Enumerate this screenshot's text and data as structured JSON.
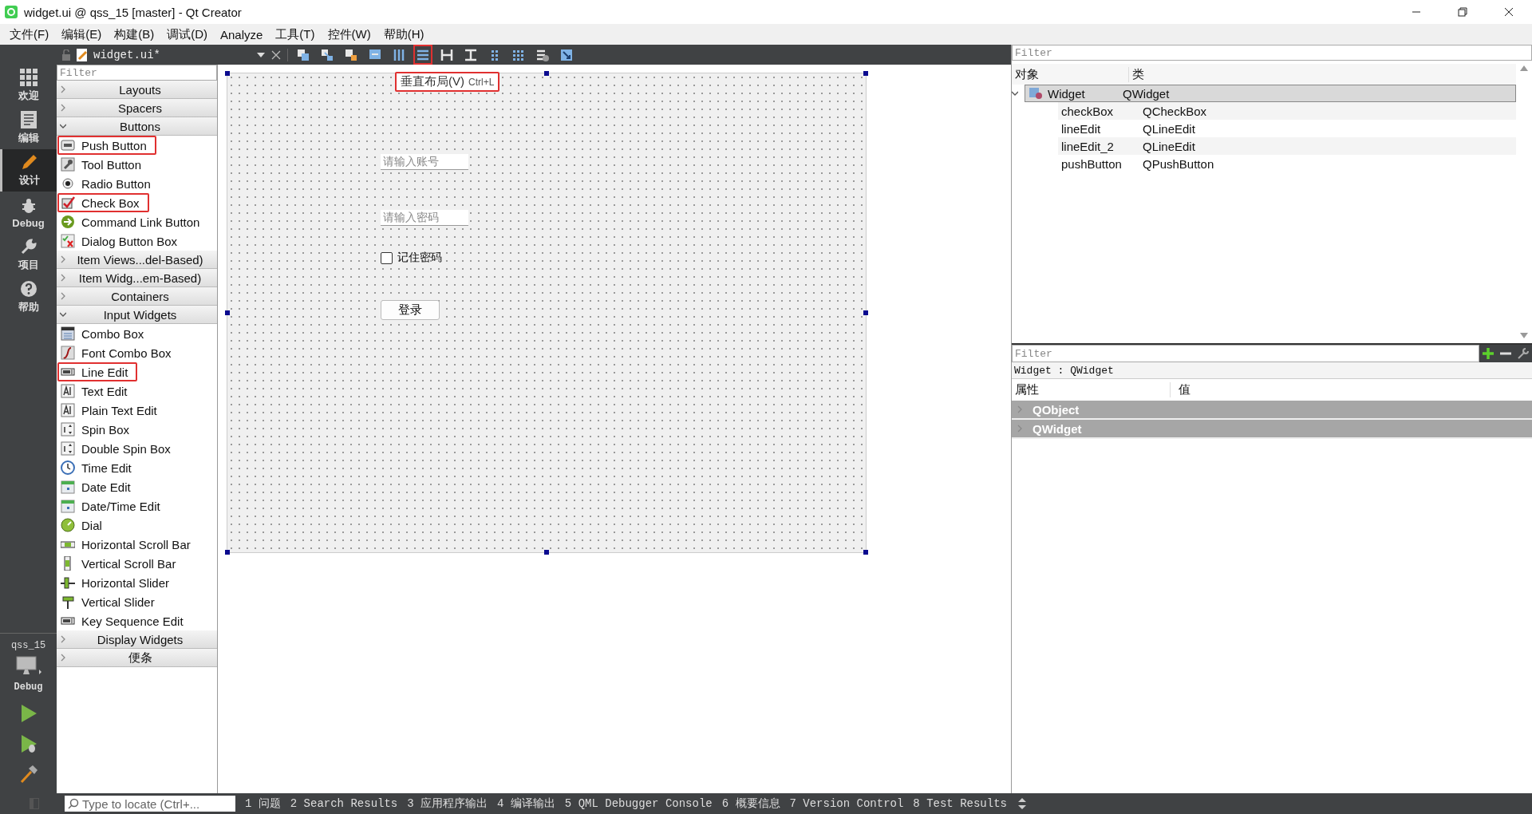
{
  "window": {
    "title": "widget.ui @ qss_15 [master] - Qt Creator"
  },
  "menu": [
    "文件(F)",
    "编辑(E)",
    "构建(B)",
    "调试(D)",
    "Analyze",
    "工具(T)",
    "控件(W)",
    "帮助(H)"
  ],
  "modes": [
    {
      "label": "欢迎",
      "kind": "grid",
      "selected": false
    },
    {
      "label": "编辑",
      "kind": "doc",
      "selected": false
    },
    {
      "label": "设计",
      "kind": "pencil",
      "selected": true
    },
    {
      "label": "Debug",
      "kind": "bug",
      "selected": false
    },
    {
      "label": "项目",
      "kind": "wrench",
      "selected": false
    },
    {
      "label": "帮助",
      "kind": "help",
      "selected": false
    }
  ],
  "kit": {
    "project": "qss_15",
    "config": "Debug"
  },
  "toolbar": {
    "file": "widget.ui*",
    "tools": [
      {
        "kind": "edit-widgets",
        "highlighted": false
      },
      {
        "kind": "signals",
        "highlighted": false
      },
      {
        "kind": "buddies",
        "highlighted": false
      },
      {
        "kind": "tab-order",
        "highlighted": false
      },
      {
        "kind": "h-layout",
        "highlighted": false
      },
      {
        "kind": "v-layout",
        "highlighted": true
      },
      {
        "kind": "h-splitter",
        "highlighted": false
      },
      {
        "kind": "v-splitter",
        "highlighted": false
      },
      {
        "kind": "form-layout",
        "highlighted": false
      },
      {
        "kind": "grid-layout",
        "highlighted": false
      },
      {
        "kind": "break-layout",
        "highlighted": false
      },
      {
        "kind": "adjust-size",
        "highlighted": false
      }
    ]
  },
  "tooltip": {
    "text": "垂直布局(V)",
    "shortcut": "Ctrl+L",
    "highlighted": true
  },
  "widget_box": {
    "filter_placeholder": "Filter",
    "sections": [
      {
        "title": "Layouts",
        "expanded": false
      },
      {
        "title": "Spacers",
        "expanded": false
      },
      {
        "title": "Buttons",
        "expanded": true,
        "items": [
          {
            "label": "Push Button",
            "kind": "ok",
            "highlighted": true
          },
          {
            "label": "Tool Button",
            "kind": "tool",
            "highlighted": false
          },
          {
            "label": "Radio Button",
            "kind": "radio",
            "highlighted": false
          },
          {
            "label": "Check Box",
            "kind": "check",
            "highlighted": true
          },
          {
            "label": "Command Link Button",
            "kind": "arrow",
            "highlighted": false
          },
          {
            "label": "Dialog Button Box",
            "kind": "dialog",
            "highlighted": false
          }
        ]
      },
      {
        "title": "Item Views...del-Based)",
        "expanded": false
      },
      {
        "title": "Item Widg...em-Based)",
        "expanded": false
      },
      {
        "title": "Containers",
        "expanded": false
      },
      {
        "title": "Input Widgets",
        "expanded": true,
        "items": [
          {
            "label": "Combo Box",
            "kind": "combo",
            "highlighted": false
          },
          {
            "label": "Font Combo Box",
            "kind": "font",
            "highlighted": false
          },
          {
            "label": "Line Edit",
            "kind": "lineedit",
            "highlighted": true
          },
          {
            "label": "Text Edit",
            "kind": "text",
            "highlighted": false
          },
          {
            "label": "Plain Text Edit",
            "kind": "text",
            "highlighted": false
          },
          {
            "label": "Spin Box",
            "kind": "spin",
            "highlighted": false
          },
          {
            "label": "Double Spin Box",
            "kind": "spin",
            "highlighted": false
          },
          {
            "label": "Time Edit",
            "kind": "clock",
            "highlighted": false
          },
          {
            "label": "Date Edit",
            "kind": "calendar",
            "highlighted": false
          },
          {
            "label": "Date/Time Edit",
            "kind": "calendar",
            "highlighted": false
          },
          {
            "label": "Dial",
            "kind": "dial",
            "highlighted": false
          },
          {
            "label": "Horizontal Scroll Bar",
            "kind": "hscroll",
            "highlighted": false
          },
          {
            "label": "Vertical Scroll Bar",
            "kind": "vscroll",
            "highlighted": false
          },
          {
            "label": "Horizontal Slider",
            "kind": "hslider",
            "highlighted": false
          },
          {
            "label": "Vertical Slider",
            "kind": "vslider",
            "highlighted": false
          },
          {
            "label": "Key Sequence Edit",
            "kind": "lineedit",
            "highlighted": false
          }
        ]
      },
      {
        "title": "Display Widgets",
        "expanded": false
      },
      {
        "title": "便条",
        "expanded": false
      }
    ]
  },
  "form": {
    "fields": [
      {
        "placeholder": "请输入账号"
      },
      {
        "placeholder": "请输入密码"
      }
    ],
    "checkbox": {
      "label": "记住密码",
      "checked": false
    },
    "button": "登录"
  },
  "object_inspector": {
    "filter_placeholder": "Filter",
    "columns": [
      "对象",
      "类"
    ],
    "rows": [
      {
        "object": "Widget",
        "class": "QWidget",
        "selected": true,
        "expanded": true,
        "children": [
          {
            "object": "checkBox",
            "class": "QCheckBox",
            "selected": false
          },
          {
            "object": "lineEdit",
            "class": "QLineEdit",
            "selected": false
          },
          {
            "object": "lineEdit_2",
            "class": "QLineEdit",
            "selected": false
          },
          {
            "object": "pushButton",
            "class": "QPushButton",
            "selected": false
          }
        ]
      }
    ]
  },
  "property_editor": {
    "filter_placeholder": "Filter",
    "title": "Widget : QWidget",
    "columns": [
      "属性",
      "值"
    ],
    "groups": [
      {
        "name": "QObject",
        "expanded": false
      },
      {
        "name": "QWidget",
        "expanded": false
      }
    ]
  },
  "status_bar": {
    "locator_placeholder": "Type to locate (Ctrl+...",
    "panes": [
      "1 问题",
      "2 Search Results",
      "3 应用程序输出",
      "4 编译输出",
      "5 QML Debugger Console",
      "6 概要信息",
      "7 Version Control",
      "8 Test Results"
    ]
  }
}
